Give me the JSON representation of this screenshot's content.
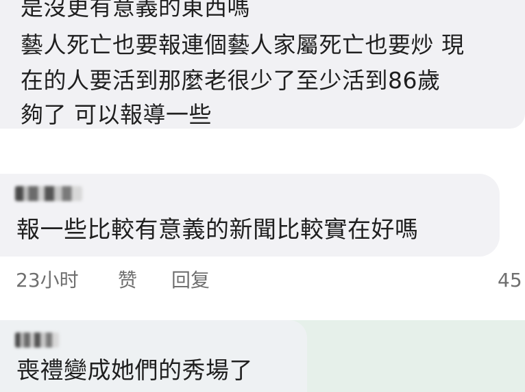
{
  "comment_previous": {
    "lines": [
      "是沒更有意義的東西嗎",
      "藝人死亡也要報連個藝人家屬死亡也要炒 現",
      "在的人要活到那麼老很少了至少活到86歲",
      "夠了 可以報導一些"
    ]
  },
  "comment_main": {
    "text": "報一些比較有意義的新聞比較實在好嗎",
    "time": "23小时",
    "like_label": "赞",
    "reply_label": "回复",
    "like_count": "45"
  },
  "comment_next": {
    "text": "喪禮變成她們的秀場了"
  }
}
